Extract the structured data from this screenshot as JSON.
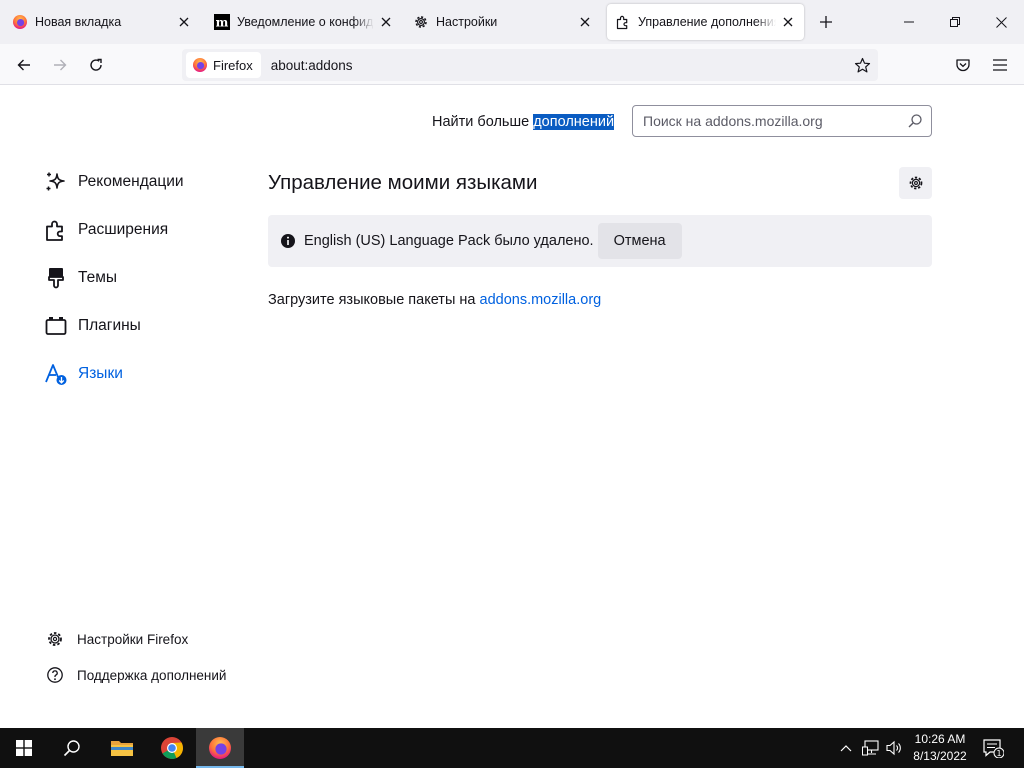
{
  "tabs": [
    {
      "title": "Новая вкладка",
      "icon": "firefox-icon"
    },
    {
      "title": "Уведомление о конфиденциальности",
      "icon": "mozilla-m-icon"
    },
    {
      "title": "Настройки",
      "icon": "gear-icon"
    },
    {
      "title": "Управление дополнениями",
      "icon": "puzzle-icon",
      "active": true
    }
  ],
  "urlbar": {
    "identity_label": "Firefox",
    "url": "about:addons"
  },
  "page": {
    "find_more_prefix": "Найти больше ",
    "find_more_highlight": "дополнений",
    "search_placeholder": "Поиск на addons.mozilla.org",
    "heading": "Управление моими языками",
    "message": "English (US) Language Pack было удалено.",
    "undo_label": "Отмена",
    "get_langs_prefix": "Загрузите языковые пакеты на ",
    "get_langs_link": "addons.mozilla.org"
  },
  "categories": [
    {
      "label": "Рекомендации",
      "icon": "sparkle-icon"
    },
    {
      "label": "Расширения",
      "icon": "puzzle-icon"
    },
    {
      "label": "Темы",
      "icon": "paintbrush-icon"
    },
    {
      "label": "Плагины",
      "icon": "plugin-icon"
    },
    {
      "label": "Языки",
      "icon": "language-icon",
      "selected": true
    }
  ],
  "footer_links": [
    {
      "label": "Настройки Firefox",
      "icon": "gear-icon"
    },
    {
      "label": "Поддержка дополнений",
      "icon": "help-icon"
    }
  ],
  "taskbar": {
    "time": "10:26 AM",
    "date": "8/13/2022",
    "notification_count": "1"
  },
  "colors": {
    "accent": "#0061e0",
    "highlight": "#0a5cc2",
    "taskbar": "#101010"
  }
}
